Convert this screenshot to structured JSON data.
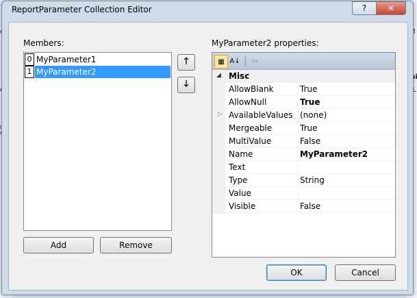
{
  "dialog": {
    "title": "ReportParameter Collection Editor",
    "help_label": "?",
    "close_label": "✕",
    "members_label": "Members:",
    "properties_label": "MyParameter2 properties:",
    "add_label": "Add",
    "remove_label": "Remove",
    "ok_label": "OK",
    "cancel_label": "Cancel",
    "move_up_label": "🡑",
    "move_down_label": "🡓"
  },
  "members": [
    {
      "index": "0",
      "name": "MyParameter1",
      "selected": false
    },
    {
      "index": "1",
      "name": "MyParameter2",
      "selected": true
    }
  ],
  "toolbar": {
    "categorized_icon": "▦",
    "alphabetical_icon": "A↓",
    "property_pages_icon": "▭"
  },
  "property_grid": {
    "category": "Misc",
    "properties": [
      {
        "name": "AllowBlank",
        "value": "True",
        "bold": false,
        "expandable": false
      },
      {
        "name": "AllowNull",
        "value": "True",
        "bold": true,
        "expandable": false
      },
      {
        "name": "AvailableValues",
        "value": "(none)",
        "bold": false,
        "expandable": true
      },
      {
        "name": "Mergeable",
        "value": "True",
        "bold": false,
        "expandable": false
      },
      {
        "name": "MultiValue",
        "value": "False",
        "bold": false,
        "expandable": false
      },
      {
        "name": "Name",
        "value": "MyParameter2",
        "bold": true,
        "expandable": false
      },
      {
        "name": "Text",
        "value": "",
        "bold": false,
        "expandable": false
      },
      {
        "name": "Type",
        "value": "String",
        "bold": false,
        "expandable": false
      },
      {
        "name": "Value",
        "value": "",
        "bold": false,
        "expandable": false
      },
      {
        "name": "Visible",
        "value": "False",
        "bold": false,
        "expandable": false
      }
    ]
  },
  "background": {
    "left_1": "ei",
    "left_2": "ei",
    "left_3": "b D",
    "left_4": "N",
    "right_1": "M",
    "right_2": "mi",
    "right_3": "s.L"
  }
}
